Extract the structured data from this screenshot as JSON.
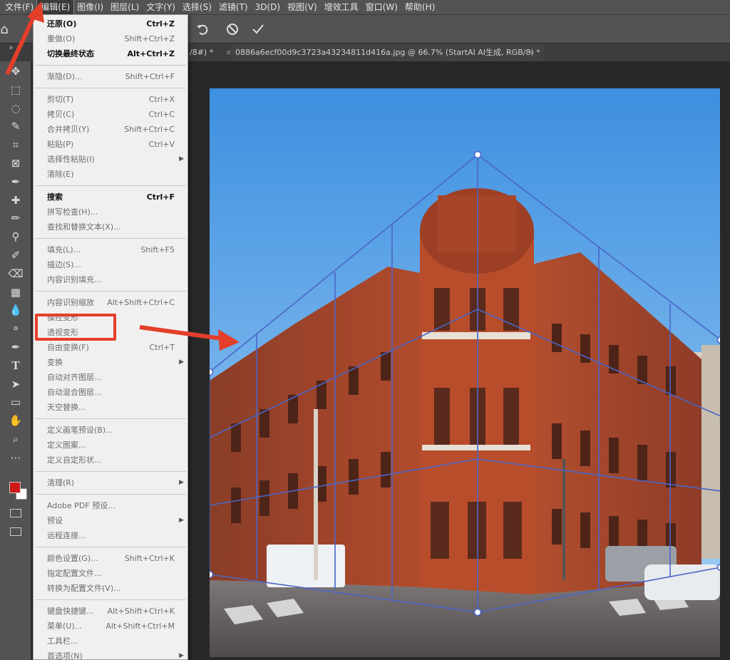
{
  "menubar": {
    "items": [
      "文件(F)",
      "编辑(E)",
      "图像(I)",
      "图层(L)",
      "文字(Y)",
      "选择(S)",
      "滤镜(T)",
      "3D(D)",
      "视图(V)",
      "增效工具",
      "窗口(W)",
      "帮助(H)"
    ]
  },
  "tabs": {
    "partial_label": "/8#) *",
    "active_label": "0886a6ecf00d9c3723a43234811d416a.jpg @ 66.7% (StartAI AI生成, RGB/8) *",
    "close_glyph": "×"
  },
  "options": {
    "undo_icon": "rotate-left-icon",
    "cancel_icon": "cancel-icon",
    "commit_icon": "check-icon"
  },
  "edit_menu": {
    "items": [
      {
        "label": "还原(O)",
        "shortcut": "Ctrl+Z",
        "state": "enabled"
      },
      {
        "label": "重做(O)",
        "shortcut": "Shift+Ctrl+Z",
        "state": "disabled"
      },
      {
        "label": "切换最终状态",
        "shortcut": "Alt+Ctrl+Z",
        "state": "enabled"
      },
      {
        "label": "渐隐(D)...",
        "shortcut": "Shift+Ctrl+F",
        "state": "disabled"
      },
      {
        "label": "剪切(T)",
        "shortcut": "Ctrl+X",
        "state": "disabled"
      },
      {
        "label": "拷贝(C)",
        "shortcut": "Ctrl+C",
        "state": "disabled"
      },
      {
        "label": "合并拷贝(Y)",
        "shortcut": "Shift+Ctrl+C",
        "state": "disabled"
      },
      {
        "label": "粘贴(P)",
        "shortcut": "Ctrl+V",
        "state": "disabled"
      },
      {
        "label": "选择性粘贴(I)",
        "shortcut": "",
        "state": "disabled",
        "submenu": true
      },
      {
        "label": "清除(E)",
        "shortcut": "",
        "state": "disabled"
      },
      {
        "label": "搜索",
        "shortcut": "Ctrl+F",
        "state": "enabled"
      },
      {
        "label": "拼写检查(H)...",
        "shortcut": "",
        "state": "disabled"
      },
      {
        "label": "查找和替换文本(X)...",
        "shortcut": "",
        "state": "disabled"
      },
      {
        "label": "填充(L)...",
        "shortcut": "Shift+F5",
        "state": "disabled"
      },
      {
        "label": "描边(S)...",
        "shortcut": "",
        "state": "disabled"
      },
      {
        "label": "内容识别填充...",
        "shortcut": "",
        "state": "disabled"
      },
      {
        "label": "内容识别缩放",
        "shortcut": "Alt+Shift+Ctrl+C",
        "state": "disabled"
      },
      {
        "label": "操控变形",
        "shortcut": "",
        "state": "disabled"
      },
      {
        "label": "透视变形",
        "shortcut": "",
        "state": "disabled"
      },
      {
        "label": "自由变换(F)",
        "shortcut": "Ctrl+T",
        "state": "disabled"
      },
      {
        "label": "变换",
        "shortcut": "",
        "state": "disabled",
        "submenu": true
      },
      {
        "label": "自动对齐图层...",
        "shortcut": "",
        "state": "disabled"
      },
      {
        "label": "自动混合图层...",
        "shortcut": "",
        "state": "disabled"
      },
      {
        "label": "天空替换...",
        "shortcut": "",
        "state": "disabled"
      },
      {
        "label": "定义画笔预设(B)...",
        "shortcut": "",
        "state": "disabled"
      },
      {
        "label": "定义图案...",
        "shortcut": "",
        "state": "disabled"
      },
      {
        "label": "定义自定形状...",
        "shortcut": "",
        "state": "disabled"
      },
      {
        "label": "清理(R)",
        "shortcut": "",
        "state": "disabled",
        "submenu": true
      },
      {
        "label": "Adobe PDF 预设...",
        "shortcut": "",
        "state": "disabled"
      },
      {
        "label": "预设",
        "shortcut": "",
        "state": "disabled",
        "submenu": true
      },
      {
        "label": "远程连接...",
        "shortcut": "",
        "state": "disabled"
      },
      {
        "label": "颜色设置(G)...",
        "shortcut": "Shift+Ctrl+K",
        "state": "disabled"
      },
      {
        "label": "指定配置文件...",
        "shortcut": "",
        "state": "disabled"
      },
      {
        "label": "转换为配置文件(V)...",
        "shortcut": "",
        "state": "disabled"
      },
      {
        "label": "键盘快捷键...",
        "shortcut": "Alt+Shift+Ctrl+K",
        "state": "disabled"
      },
      {
        "label": "菜单(U)...",
        "shortcut": "Alt+Shift+Ctrl+M",
        "state": "disabled"
      },
      {
        "label": "工具栏...",
        "shortcut": "",
        "state": "disabled"
      },
      {
        "label": "首选项(N)",
        "shortcut": "",
        "state": "disabled",
        "submenu": true
      }
    ]
  },
  "toolbar": {
    "tools": [
      "move-icon",
      "marquee-icon",
      "lasso-icon",
      "quick-select-icon",
      "crop-icon",
      "frame-icon",
      "eyedropper-icon",
      "healing-icon",
      "brush-icon",
      "stamp-icon",
      "history-brush-icon",
      "eraser-icon",
      "gradient-icon",
      "blur-icon",
      "dodge-icon",
      "pen-icon",
      "type-icon",
      "path-select-icon",
      "rectangle-icon",
      "hand-icon",
      "zoom-icon",
      "more-icon"
    ],
    "foreground_color": "#d01818",
    "background_color": "#ffffff"
  },
  "theme": {
    "accent_red": "#e33f2a",
    "transform_line": "#4a66c8"
  },
  "chrome_glyphs": {
    "panel_collapse": "»",
    "submenu_arrow": "▶"
  }
}
